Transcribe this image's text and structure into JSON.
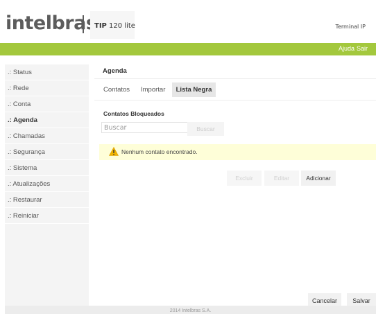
{
  "header": {
    "logo_text": "intelbras",
    "model_bold": "TIP",
    "model_rest": " 120 lite",
    "terminal_label": "Terminal IP"
  },
  "topbar": {
    "help": "Ajuda",
    "exit": "Sair",
    "color": "#a3c83d"
  },
  "sidebar": {
    "items": [
      {
        "label": ".: Status",
        "active": false
      },
      {
        "label": ".: Rede",
        "active": false
      },
      {
        "label": ".: Conta",
        "active": false
      },
      {
        "label": ".: Agenda",
        "active": true
      },
      {
        "label": ".: Chamadas",
        "active": false
      },
      {
        "label": ".: Segurança",
        "active": false
      },
      {
        "label": ".: Sistema",
        "active": false
      },
      {
        "label": ".: Atualizações",
        "active": false
      },
      {
        "label": ".: Restaurar",
        "active": false
      },
      {
        "label": ".: Reiniciar",
        "active": false
      }
    ]
  },
  "panel": {
    "title": "Agenda",
    "tabs": [
      {
        "label": "Contatos",
        "active": false
      },
      {
        "label": "Importar",
        "active": false
      },
      {
        "label": "Lista Negra",
        "active": true
      }
    ]
  },
  "blocked": {
    "section_title": "Contatos Bloqueados",
    "search_placeholder": "Buscar",
    "search_button": "Buscar",
    "alert_icon": "warning-icon",
    "alert_text": "Nenhum contato encontrado."
  },
  "actions": {
    "delete": "Excluir",
    "edit": "Editar",
    "add": "Adicionar"
  },
  "form_actions": {
    "cancel": "Cancelar",
    "save": "Salvar"
  },
  "footer": {
    "text": "2014 Intelbras S.A."
  }
}
